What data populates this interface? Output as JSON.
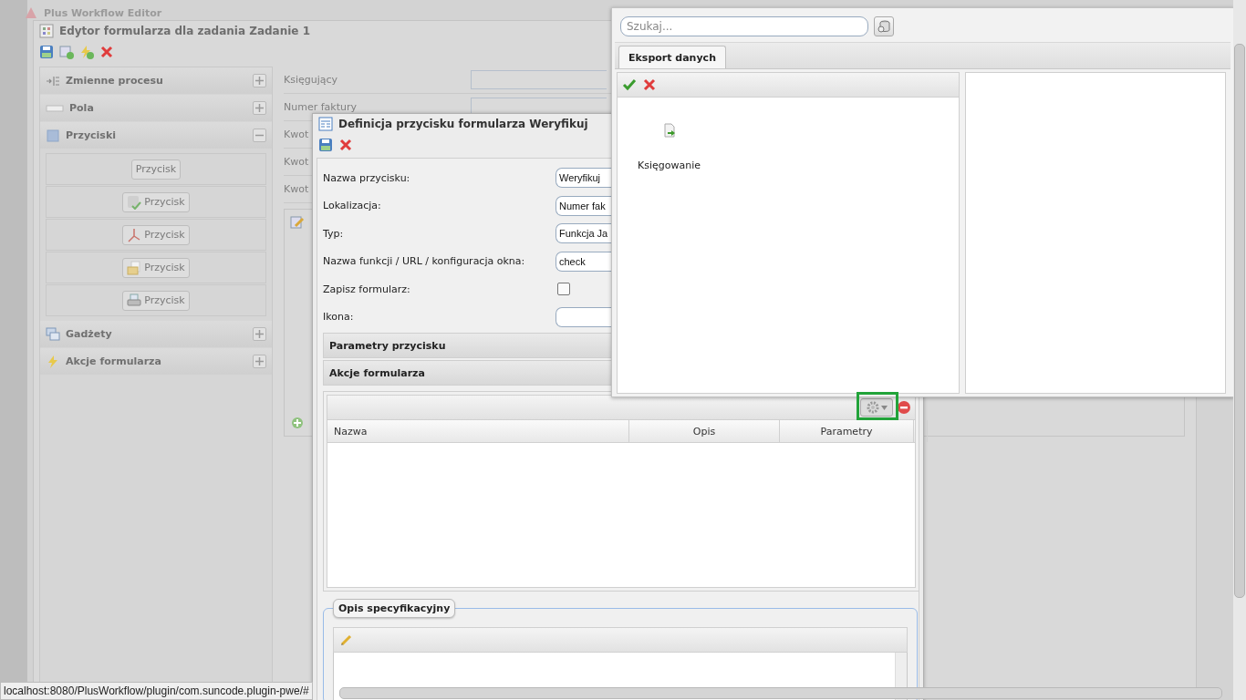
{
  "app": {
    "title": "Plus Workflow Editor"
  },
  "editor": {
    "title": "Edytor formularza dla zadania Zadanie 1",
    "accordion": [
      {
        "label": "Zmienne procesu",
        "expanded": false
      },
      {
        "label": "Pola",
        "expanded": false
      },
      {
        "label": "Przyciski",
        "expanded": true,
        "buttons": [
          {
            "label": "Przycisk"
          },
          {
            "label": "Przycisk"
          },
          {
            "label": "Przycisk"
          },
          {
            "label": "Przycisk"
          },
          {
            "label": "Przycisk"
          }
        ]
      },
      {
        "label": "Gadżety",
        "expanded": false
      },
      {
        "label": "Akcje formularza",
        "expanded": false
      }
    ],
    "form_fields": [
      "Księgujący",
      "Numer faktury",
      "Kwot",
      "Kwot",
      "Kwot"
    ]
  },
  "dialog": {
    "title": "Definicja przycisku formularza Weryfikuj",
    "fields": [
      {
        "label": "Nazwa przycisku:",
        "kind": "text",
        "value": "Weryfikuj"
      },
      {
        "label": "Lokalizacja:",
        "kind": "text",
        "value": "Numer fak"
      },
      {
        "label": "Typ:",
        "kind": "text",
        "value": "Funkcja Ja"
      },
      {
        "label": "Nazwa funkcji / URL / konfiguracja okna:",
        "kind": "text",
        "value": "check"
      },
      {
        "label": "Zapisz formularz:",
        "kind": "checkbox",
        "checked": false
      },
      {
        "label": "Ikona:",
        "kind": "text"
      }
    ],
    "sections": [
      "Parametry przycisku",
      "Akcje formularza"
    ],
    "table": {
      "columns": [
        "Nazwa",
        "Opis",
        "Parametry"
      ]
    },
    "fieldset": {
      "legend": "Opis specyfikacyjny"
    }
  },
  "popup": {
    "search": {
      "placeholder": "Szukaj..."
    },
    "tabs": [
      {
        "label": "Eksport danych",
        "selected": true
      }
    ],
    "items": [
      {
        "label": "Księgowanie"
      }
    ]
  },
  "status_bar": {
    "url": "localhost:8080/PlusWorkflow/plugin/com.suncode.plugin-pwe/#"
  }
}
